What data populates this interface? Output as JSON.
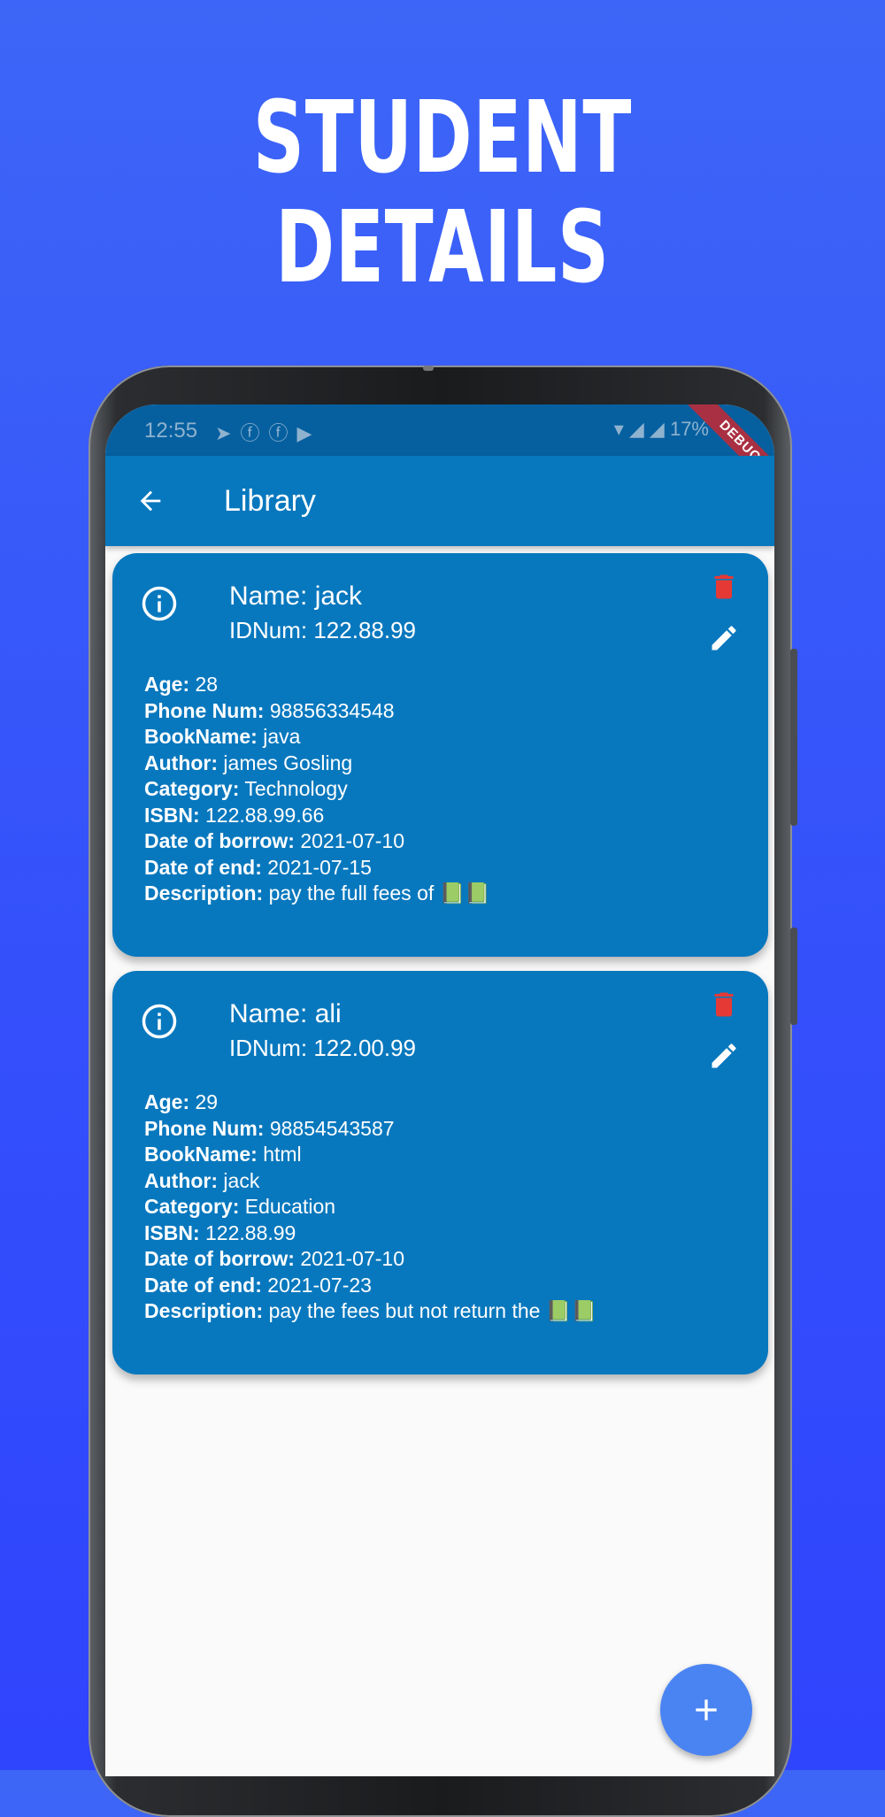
{
  "headline": {
    "line1": "STUDENT",
    "line2": "DETAILS"
  },
  "status_bar": {
    "time": "12:55",
    "app_icons": [
      "telegram-icon",
      "facebook-icon",
      "facebook-icon",
      "youtube-icon"
    ],
    "battery": "17%",
    "debug_banner": "DEBUG"
  },
  "app_bar": {
    "title": "Library",
    "back_icon": "arrow-back-icon"
  },
  "students": [
    {
      "name": "Name: jack",
      "idnum": "IDNum: 122.88.99",
      "fields": [
        {
          "label": "Age:",
          "value": "28"
        },
        {
          "label": "Phone Num:",
          "value": "98856334548"
        },
        {
          "label": "BookName:",
          "value": "java"
        },
        {
          "label": "Author:",
          "value": "james Gosling"
        },
        {
          "label": "Category:",
          "value": "Technology"
        },
        {
          "label": "ISBN:",
          "value": "122.88.99.66"
        },
        {
          "label": "Date of borrow:",
          "value": "2021-07-10"
        },
        {
          "label": "Date of end:",
          "value": "2021-07-15"
        },
        {
          "label": "Description:",
          "value": "pay the full fees of 📗📗"
        }
      ]
    },
    {
      "name": "Name: ali",
      "idnum": "IDNum: 122.00.99",
      "fields": [
        {
          "label": "Age:",
          "value": "29"
        },
        {
          "label": "Phone Num:",
          "value": "98854543587"
        },
        {
          "label": "BookName:",
          "value": "html"
        },
        {
          "label": "Author:",
          "value": "jack"
        },
        {
          "label": "Category:",
          "value": "Education"
        },
        {
          "label": "ISBN:",
          "value": "122.88.99"
        },
        {
          "label": "Date of borrow:",
          "value": "2021-07-10"
        },
        {
          "label": "Date of end:",
          "value": "2021-07-23"
        },
        {
          "label": "Description:",
          "value": "pay the fees but not return the 📗📗"
        }
      ]
    }
  ],
  "colors": {
    "background": "#3450fb",
    "app_bar": "#0878be",
    "card": "#0878be",
    "delete_icon": "#e53935",
    "fab": "#4a84f2"
  },
  "fab": {
    "icon": "add-icon"
  }
}
